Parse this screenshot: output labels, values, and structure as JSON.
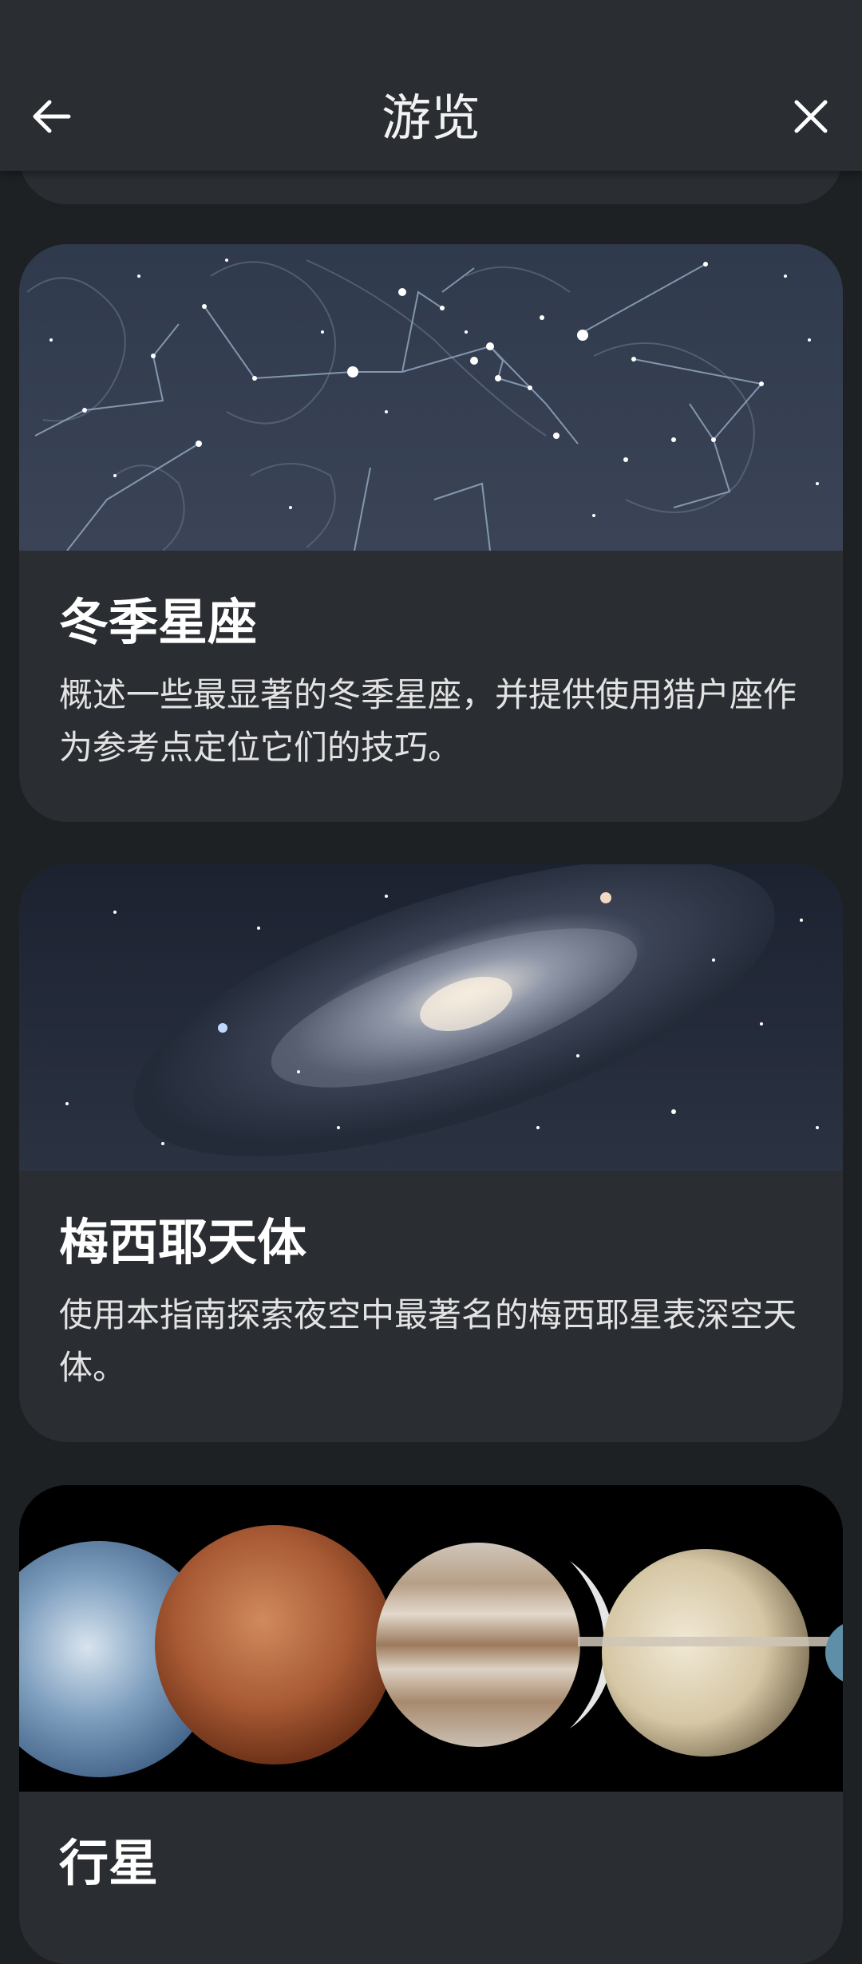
{
  "header": {
    "title": "游览",
    "back_icon": "arrow-left-icon",
    "close_icon": "close-icon"
  },
  "cards": [
    {
      "title": "冬季星座",
      "description": "概述一些最显著的冬季星座，并提供使用猎户座作为参考点定位它们的技巧。",
      "image": "winter-constellations-image"
    },
    {
      "title": "梅西耶天体",
      "description": "使用本指南探索夜空中最著名的梅西耶星表深空天体。",
      "image": "galaxy-image"
    },
    {
      "title": "行星",
      "description": "",
      "image": "planets-image"
    }
  ],
  "colors": {
    "background": "#1e2124",
    "card": "#2a2d31",
    "appbar": "#2a2d31"
  }
}
